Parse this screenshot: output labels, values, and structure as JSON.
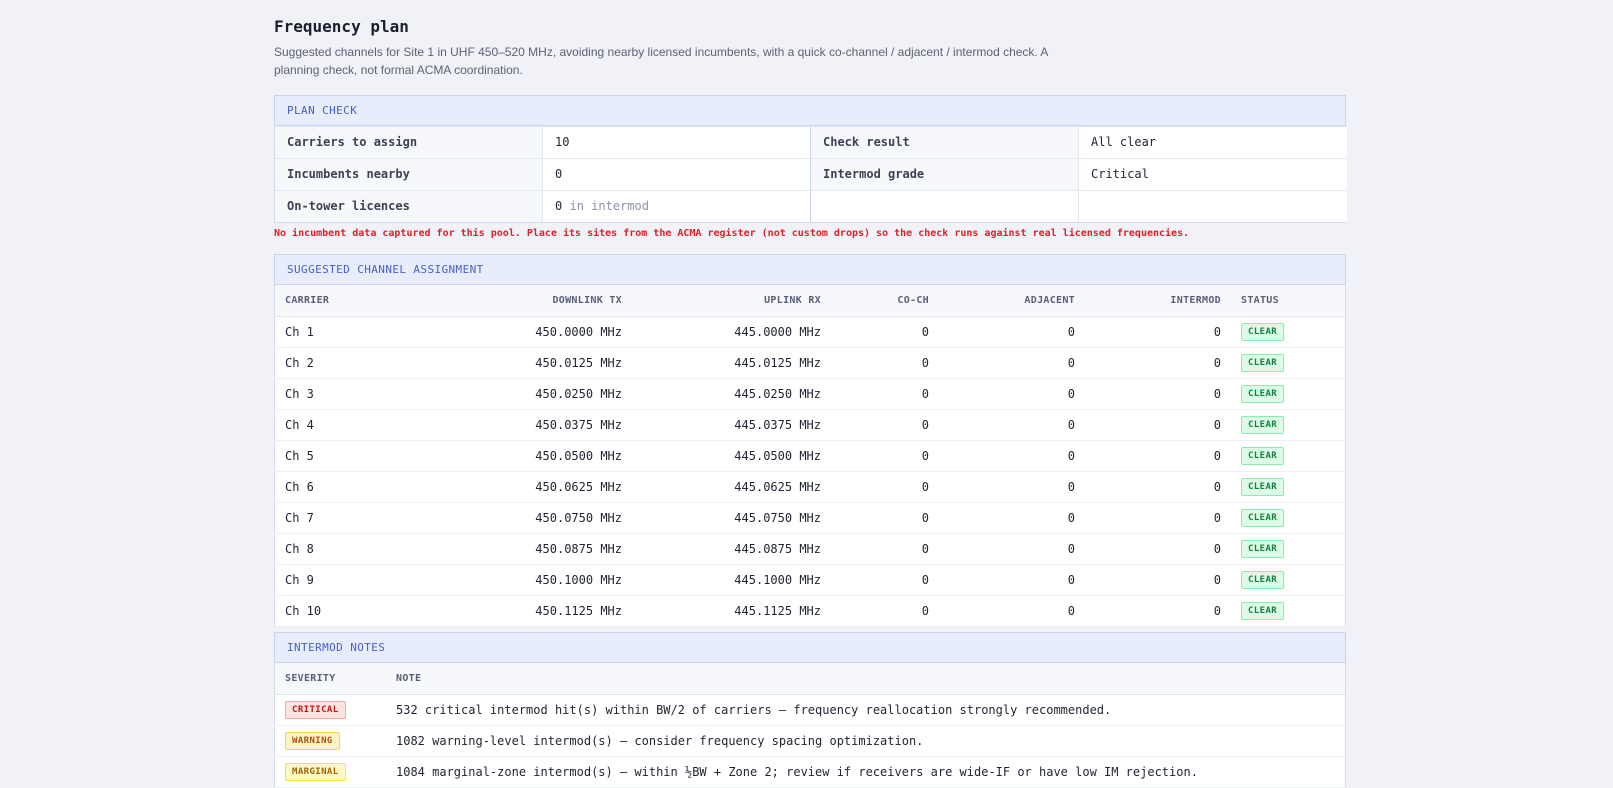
{
  "page": {
    "title": "Frequency plan",
    "subtitle": "Suggested channels for Site 1 in UHF 450–520 MHz, avoiding nearby licensed incumbents, with a quick co-channel / adjacent / intermod check. A planning check, not formal ACMA coordination."
  },
  "plan_check": {
    "heading": "PLAN CHECK",
    "carriers_label": "Carriers to assign",
    "carriers_value": "10",
    "check_result_label": "Check result",
    "check_result_value": "All clear",
    "incumbents_label": "Incumbents nearby",
    "incumbents_value": "0",
    "intermod_grade_label": "Intermod grade",
    "intermod_grade_value": "Critical",
    "on_tower_label": "On-tower licences",
    "on_tower_value": "0",
    "on_tower_suffix": "in intermod"
  },
  "warning_text": "No incumbent data captured for this pool. Place its sites from the ACMA register (not custom drops) so the check runs against real licensed frequencies.",
  "assignment": {
    "heading": "SUGGESTED CHANNEL ASSIGNMENT",
    "columns": [
      "CARRIER",
      "DOWNLINK TX",
      "UPLINK RX",
      "CO-CH",
      "ADJACENT",
      "INTERMOD",
      "STATUS"
    ],
    "rows": [
      {
        "carrier": "Ch 1",
        "tx": "450.0000 MHz",
        "rx": "445.0000 MHz",
        "coch": "0",
        "adj": "0",
        "im": "0",
        "status": "CLEAR"
      },
      {
        "carrier": "Ch 2",
        "tx": "450.0125 MHz",
        "rx": "445.0125 MHz",
        "coch": "0",
        "adj": "0",
        "im": "0",
        "status": "CLEAR"
      },
      {
        "carrier": "Ch 3",
        "tx": "450.0250 MHz",
        "rx": "445.0250 MHz",
        "coch": "0",
        "adj": "0",
        "im": "0",
        "status": "CLEAR"
      },
      {
        "carrier": "Ch 4",
        "tx": "450.0375 MHz",
        "rx": "445.0375 MHz",
        "coch": "0",
        "adj": "0",
        "im": "0",
        "status": "CLEAR"
      },
      {
        "carrier": "Ch 5",
        "tx": "450.0500 MHz",
        "rx": "445.0500 MHz",
        "coch": "0",
        "adj": "0",
        "im": "0",
        "status": "CLEAR"
      },
      {
        "carrier": "Ch 6",
        "tx": "450.0625 MHz",
        "rx": "445.0625 MHz",
        "coch": "0",
        "adj": "0",
        "im": "0",
        "status": "CLEAR"
      },
      {
        "carrier": "Ch 7",
        "tx": "450.0750 MHz",
        "rx": "445.0750 MHz",
        "coch": "0",
        "adj": "0",
        "im": "0",
        "status": "CLEAR"
      },
      {
        "carrier": "Ch 8",
        "tx": "450.0875 MHz",
        "rx": "445.0875 MHz",
        "coch": "0",
        "adj": "0",
        "im": "0",
        "status": "CLEAR"
      },
      {
        "carrier": "Ch 9",
        "tx": "450.1000 MHz",
        "rx": "445.1000 MHz",
        "coch": "0",
        "adj": "0",
        "im": "0",
        "status": "CLEAR"
      },
      {
        "carrier": "Ch 10",
        "tx": "450.1125 MHz",
        "rx": "445.1125 MHz",
        "coch": "0",
        "adj": "0",
        "im": "0",
        "status": "CLEAR"
      }
    ]
  },
  "intermod": {
    "heading": "INTERMOD NOTES",
    "columns": [
      "SEVERITY",
      "NOTE"
    ],
    "rows": [
      {
        "severity": "CRITICAL",
        "kind": "critical",
        "note": "532 critical intermod hit(s) within BW/2 of carriers — frequency reallocation strongly recommended."
      },
      {
        "severity": "WARNING",
        "kind": "warning",
        "note": "1082 warning-level intermod(s) — consider frequency spacing optimization."
      },
      {
        "severity": "MARGINAL",
        "kind": "marginal",
        "note": "1084 marginal-zone intermod(s) — within ½BW + Zone 2; review if receivers are wide-IF or have low IM rejection."
      }
    ]
  }
}
